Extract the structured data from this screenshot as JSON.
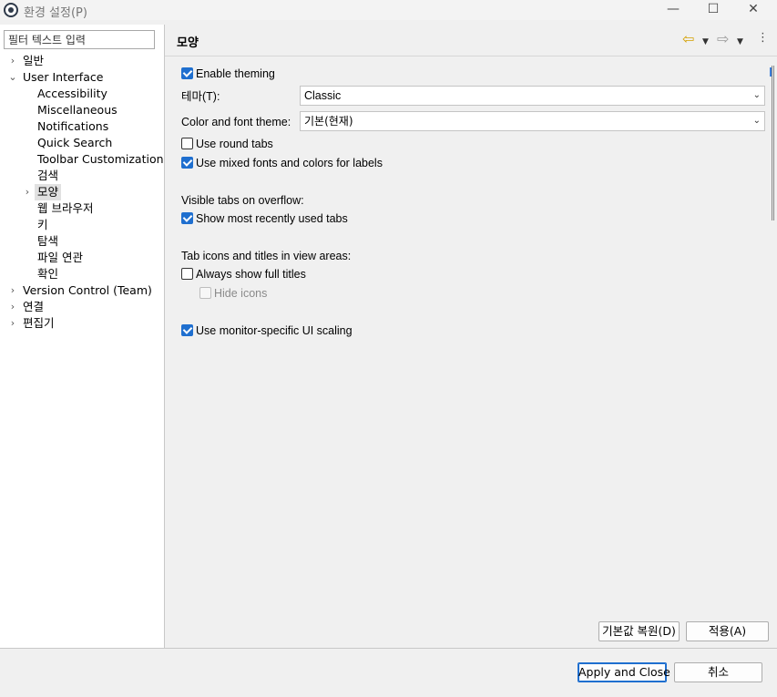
{
  "window": {
    "title": "환경 설정(P)",
    "minimize_glyph": "—",
    "maximize_glyph": "☐",
    "close_glyph": "✕"
  },
  "filter": {
    "placeholder": "필터 텍스트 입력"
  },
  "tree": {
    "items": [
      {
        "label": "일반",
        "level": 0,
        "arrow": "›"
      },
      {
        "label": "User Interface",
        "level": 0,
        "arrow": "⌄"
      },
      {
        "label": "Accessibility",
        "level": 1,
        "arrow": ""
      },
      {
        "label": "Miscellaneous",
        "level": 1,
        "arrow": ""
      },
      {
        "label": "Notifications",
        "level": 1,
        "arrow": ""
      },
      {
        "label": "Quick Search",
        "level": 1,
        "arrow": ""
      },
      {
        "label": "Toolbar Customization",
        "level": 1,
        "arrow": ""
      },
      {
        "label": "검색",
        "level": 1,
        "arrow": ""
      },
      {
        "label": "모양",
        "level": 1,
        "arrow": "›",
        "selected": true
      },
      {
        "label": "웹 브라우저",
        "level": 1,
        "arrow": ""
      },
      {
        "label": "키",
        "level": 1,
        "arrow": ""
      },
      {
        "label": "탐색",
        "level": 1,
        "arrow": ""
      },
      {
        "label": "파일 연관",
        "level": 1,
        "arrow": ""
      },
      {
        "label": "확인",
        "level": 1,
        "arrow": ""
      },
      {
        "label": "Version Control (Team)",
        "level": 0,
        "arrow": "›"
      },
      {
        "label": "연결",
        "level": 0,
        "arrow": "›"
      },
      {
        "label": "편집기",
        "level": 0,
        "arrow": "›"
      }
    ]
  },
  "page": {
    "title": "모양",
    "nav": {
      "back_glyph": "⇦",
      "fwd_glyph": "⇨",
      "drop_glyph": "▼",
      "menu_glyph": "⋮"
    }
  },
  "settings": {
    "enable_theming": {
      "label": "Enable theming",
      "checked": true
    },
    "theme": {
      "label": "테마(T):",
      "value": "Classic"
    },
    "color_font_theme": {
      "label": "Color and font theme:",
      "value": "기본(현재)"
    },
    "round_tabs": {
      "label": "Use round tabs",
      "checked": false
    },
    "mixed_fonts": {
      "label": "Use mixed fonts and colors for labels",
      "checked": true
    },
    "visible_tabs_heading": "Visible tabs on overflow:",
    "show_mru_tabs": {
      "label": "Show most recently used tabs",
      "checked": true
    },
    "tab_icons_heading": "Tab icons and titles in view areas:",
    "always_full_titles": {
      "label": "Always show full titles",
      "checked": false
    },
    "hide_icons": {
      "label": "Hide icons",
      "checked": false,
      "disabled": true
    },
    "monitor_scaling": {
      "label": "Use monitor-specific UI scaling",
      "checked": true
    },
    "combo_arrow": "⌄"
  },
  "buttons": {
    "restore_defaults": "기본값 복원(D)",
    "apply": "적용(A)",
    "apply_and_close": "Apply and Close",
    "cancel": "취소"
  },
  "colors": {
    "accent": "#1f6fcf",
    "back_arrow": "#d4a000"
  }
}
